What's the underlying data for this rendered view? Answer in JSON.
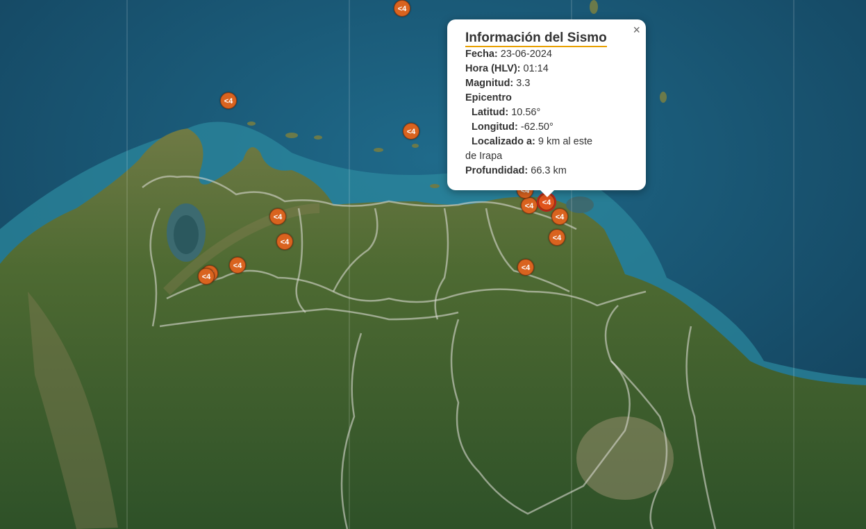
{
  "popup": {
    "title": "Información del Sismo",
    "close": "×",
    "fecha_label": "Fecha:",
    "fecha": "23-06-2024",
    "hora_label": "Hora (HLV):",
    "hora": "01:14",
    "magnitud_label": "Magnitud:",
    "magnitud": "3.3",
    "epicentro_label": "Epicentro",
    "latitud_label": "Latitud:",
    "latitud": "10.56°",
    "longitud_label": "Longitud:",
    "longitud": "-62.50°",
    "localizado_label": "Localizado a:",
    "localizado": "9 km al este",
    "localizado_cont": "de Irapa",
    "profundidad_label": "Profundidad:",
    "profundidad": "66.3 km"
  },
  "markers": [
    {
      "label": "<4"
    },
    {
      "label": "<4"
    },
    {
      "label": "<4"
    },
    {
      "label": "<4"
    },
    {
      "label": "<4"
    },
    {
      "label": "<4"
    },
    {
      "label": "<4"
    },
    {
      "label": "<4"
    },
    {
      "label": "<4"
    },
    {
      "label": "<4"
    },
    {
      "label": "<4"
    },
    {
      "label": "<4"
    },
    {
      "label": "<4"
    },
    {
      "label": "<4"
    }
  ],
  "colors": {
    "sea": "#1b4f6e",
    "land": "#4f6a33",
    "marker": "#d9631f",
    "popup_underline": "#e8a000"
  }
}
